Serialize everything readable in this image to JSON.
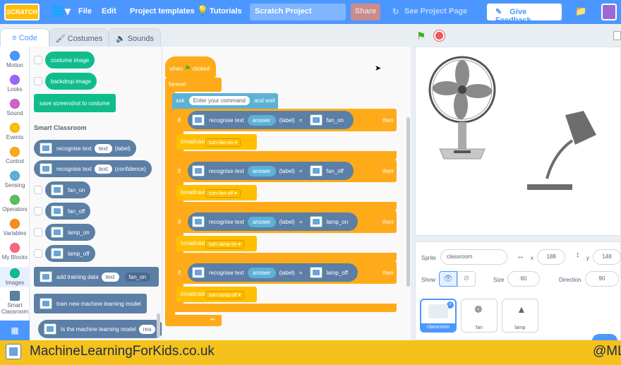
{
  "topbar": {
    "logo": "SCRATCH",
    "file": "File",
    "edit": "Edit",
    "templates": "Project templates",
    "tutorials": "Tutorials",
    "project_title": "Scratch Project",
    "share": "Share",
    "see_project": "See Project Page",
    "feedback": "Give Feedback"
  },
  "tabs": {
    "code": "Code",
    "costumes": "Costumes",
    "sounds": "Sounds"
  },
  "categories": [
    {
      "label": "Motion",
      "color": "#4c97ff"
    },
    {
      "label": "Looks",
      "color": "#9966ff"
    },
    {
      "label": "Sound",
      "color": "#cf63cf"
    },
    {
      "label": "Events",
      "color": "#ffbf00"
    },
    {
      "label": "Control",
      "color": "#ffab19"
    },
    {
      "label": "Sensing",
      "color": "#5cb1d6"
    },
    {
      "label": "Operators",
      "color": "#59c059"
    },
    {
      "label": "Variables",
      "color": "#ff8c1a"
    },
    {
      "label": "My Blocks",
      "color": "#ff6680"
    },
    {
      "label": "Images",
      "color": "#0fbd8c"
    },
    {
      "label": "Smart Classroom",
      "color": "#5b7fa6"
    }
  ],
  "palette": {
    "costume_image": "costume image",
    "backdrop_image": "backdrop image",
    "save_screenshot": "save screenshot to costume",
    "section_title": "Smart Classroom",
    "recognise_label": "recognise text",
    "text_pill": "text",
    "label_suffix": "(label)",
    "confidence_suffix": "(confidence)",
    "fan_on": "fan_on",
    "fan_off": "fan_off",
    "lamp_on": "lamp_on",
    "lamp_off": "lamp_off",
    "add_training": "add training data",
    "add_training_dd": "fan_on",
    "train_new": "train new machine learning model",
    "is_model": "Is the machine learning model",
    "is_model_dd": "rea"
  },
  "script": {
    "when": "when",
    "clicked": "clicked",
    "forever": "forever",
    "ask": "ask",
    "ask_default": "Enter your command",
    "and_wait": "and wait",
    "if": "if",
    "then": "then",
    "recognise": "recognise text",
    "answer": "answer",
    "label": "(label)",
    "eq": "=",
    "broadcast": "broadcast",
    "rows": [
      {
        "cls": "fan_on",
        "msg": "turn-fan-on"
      },
      {
        "cls": "fan_off",
        "msg": "turn-fan-off"
      },
      {
        "cls": "lamp_on",
        "msg": "turn-lamp-on"
      },
      {
        "cls": "lamp_off",
        "msg": "turn-lamp-off"
      }
    ]
  },
  "sprite_info": {
    "sprite_label": "Sprite",
    "sprite_name": "classroom",
    "x_label": "x",
    "x": "188",
    "y_label": "y",
    "y": "148",
    "show_label": "Show",
    "size_label": "Size",
    "size": "60",
    "direction_label": "Direction",
    "direction": "90"
  },
  "sprites": [
    {
      "name": "classroom",
      "selected": true
    },
    {
      "name": "fan",
      "selected": false
    },
    {
      "name": "lamp",
      "selected": false
    }
  ],
  "footer": {
    "site": "MachineLearningForKids.co.uk",
    "handle": "@ML"
  }
}
